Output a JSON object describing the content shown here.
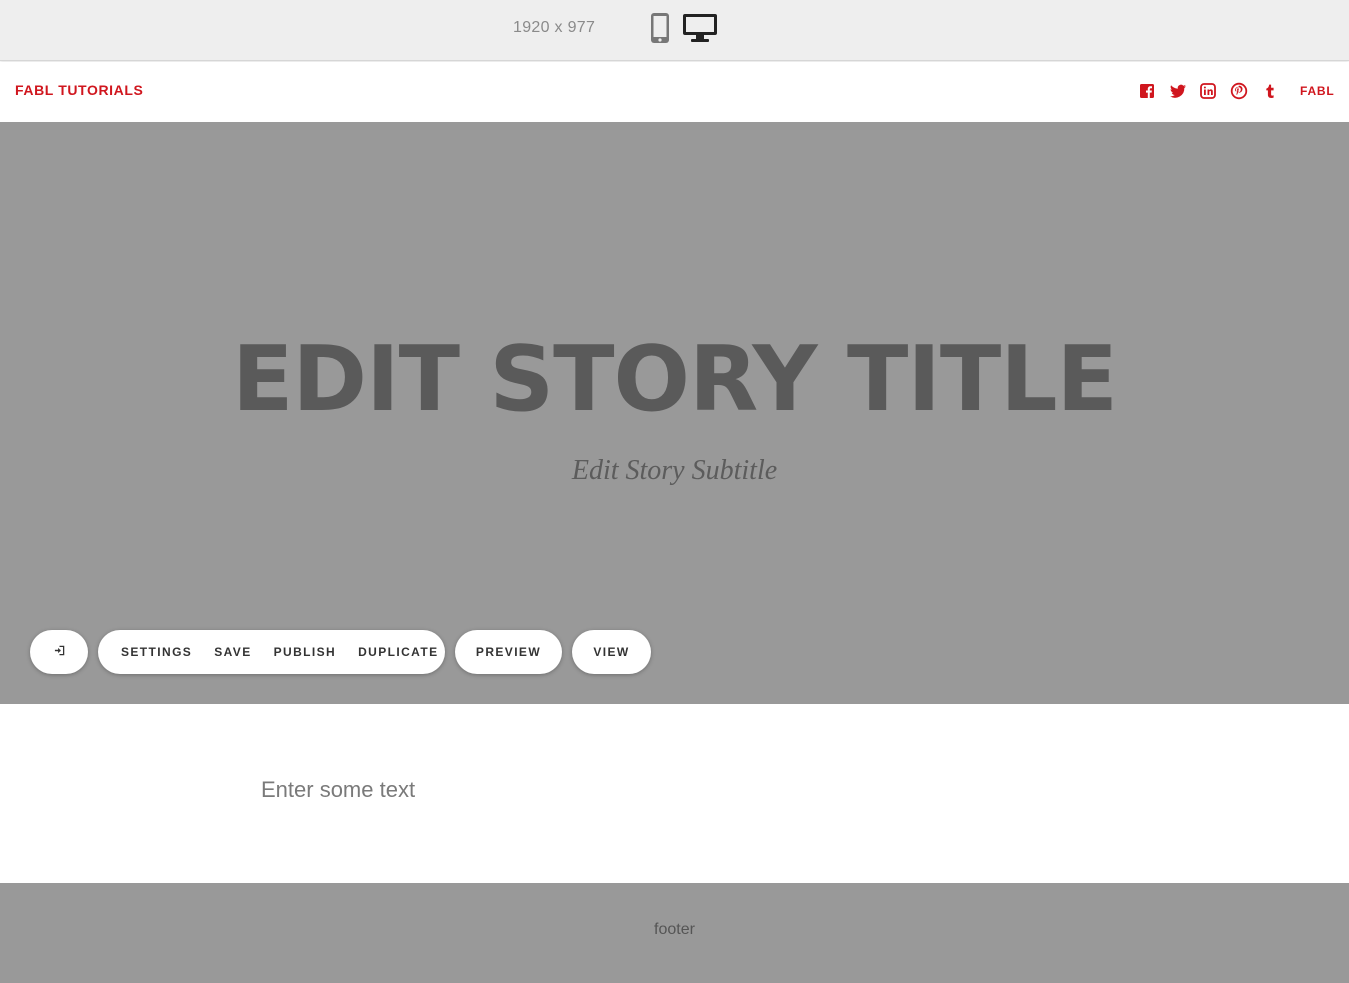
{
  "device_bar": {
    "dimensions": "1920 x 977",
    "icons": [
      "mobile-phone-icon",
      "desktop-monitor-icon"
    ]
  },
  "header": {
    "brand": "FABL TUTORIALS",
    "social_icons": [
      "facebook-icon",
      "twitter-icon",
      "linkedin-icon",
      "pinterest-icon",
      "tumblr-icon"
    ],
    "fabl_link": "FABL"
  },
  "hero": {
    "title": "EDIT STORY TITLE",
    "subtitle": "Edit Story Subtitle"
  },
  "toolbar": {
    "exit_icon": "sign-out-icon",
    "settings": "SETTINGS",
    "save": "SAVE",
    "publish": "PUBLISH",
    "duplicate": "DUPLICATE",
    "preview": "PREVIEW",
    "view": "VIEW"
  },
  "content": {
    "placeholder": "Enter some text"
  },
  "footer": {
    "text": "footer"
  },
  "colors": {
    "brand_red": "#d0161e",
    "hero_bg": "#999999",
    "device_bar_bg": "#eeeeee"
  }
}
